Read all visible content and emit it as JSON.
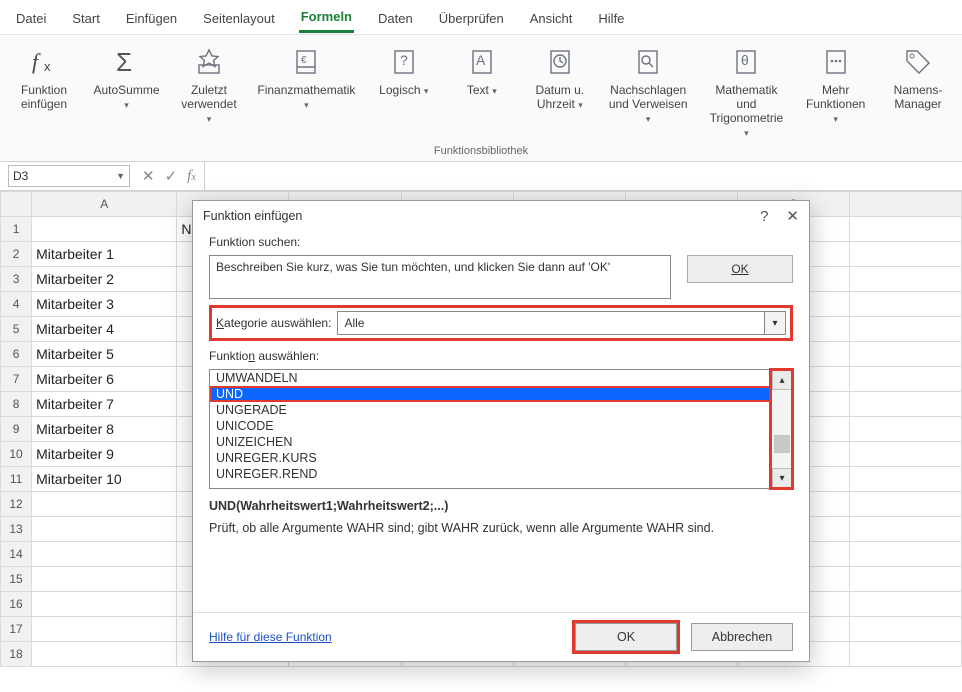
{
  "menu": {
    "items": [
      "Datei",
      "Start",
      "Einfügen",
      "Seitenlayout",
      "Formeln",
      "Daten",
      "Überprüfen",
      "Ansicht",
      "Hilfe"
    ],
    "active_index": 4
  },
  "ribbon": {
    "group_label": "Funktionsbibliothek",
    "buttons": [
      {
        "label": "Funktion\neinfügen",
        "drop": false,
        "icon": "fx"
      },
      {
        "label": "AutoSumme",
        "drop": true,
        "icon": "sigma"
      },
      {
        "label": "Zuletzt\nverwendet",
        "drop": true,
        "icon": "star"
      },
      {
        "label": "Finanzmathematik",
        "drop": true,
        "icon": "book"
      },
      {
        "label": "Logisch",
        "drop": true,
        "icon": "logic"
      },
      {
        "label": "Text",
        "drop": true,
        "icon": "text"
      },
      {
        "label": "Datum u.\nUhrzeit",
        "drop": true,
        "icon": "clock"
      },
      {
        "label": "Nachschlagen\nund Verweisen",
        "drop": true,
        "icon": "lookup"
      },
      {
        "label": "Mathematik und\nTrigonometrie",
        "drop": true,
        "icon": "theta"
      },
      {
        "label": "Mehr\nFunktionen",
        "drop": true,
        "icon": "more"
      }
    ],
    "names_mgr": {
      "label": "Namens-\nManager",
      "icon": "tag"
    }
  },
  "cell_ref": "D3",
  "columns": [
    "A",
    " ",
    " ",
    " ",
    " ",
    " ",
    "G",
    " "
  ],
  "col_A_header": "A",
  "col_G_header": "G",
  "rows": [
    {
      "n": 1,
      "a": ""
    },
    {
      "n": 2,
      "a": "Mitarbeiter 1"
    },
    {
      "n": 3,
      "a": "Mitarbeiter 2"
    },
    {
      "n": 4,
      "a": "Mitarbeiter 3"
    },
    {
      "n": 5,
      "a": "Mitarbeiter 4"
    },
    {
      "n": 6,
      "a": "Mitarbeiter 5"
    },
    {
      "n": 7,
      "a": "Mitarbeiter 6"
    },
    {
      "n": 8,
      "a": "Mitarbeiter 7"
    },
    {
      "n": 9,
      "a": "Mitarbeiter 8"
    },
    {
      "n": 10,
      "a": "Mitarbeiter 9"
    },
    {
      "n": 11,
      "a": "Mitarbeiter 10"
    },
    {
      "n": 12,
      "a": ""
    },
    {
      "n": 13,
      "a": ""
    },
    {
      "n": 14,
      "a": ""
    },
    {
      "n": 15,
      "a": ""
    },
    {
      "n": 16,
      "a": ""
    },
    {
      "n": 17,
      "a": ""
    },
    {
      "n": 18,
      "a": ""
    }
  ],
  "b1_partial": "Ne",
  "dialog": {
    "title": "Funktion einfügen",
    "search_label": "Funktion suchen:",
    "search_placeholder": "Beschreiben Sie kurz, was Sie tun möchten, und klicken Sie dann auf 'OK'",
    "search_ok": "OK",
    "cat_label": "Kategorie auswählen:",
    "cat_value": "Alle",
    "select_label": "Funktion auswählen:",
    "functions": [
      "UMWANDELN",
      "UND",
      "UNGERADE",
      "UNICODE",
      "UNIZEICHEN",
      "UNREGER.KURS",
      "UNREGER.REND"
    ],
    "selected_index": 1,
    "signature": "UND(Wahrheitswert1;Wahrheitswert2;...)",
    "description": "Prüft, ob alle Argumente WAHR sind; gibt WAHR zurück, wenn alle Argumente WAHR sind.",
    "help_link": "Hilfe für diese Funktion",
    "ok": "OK",
    "cancel": "Abbrechen"
  }
}
